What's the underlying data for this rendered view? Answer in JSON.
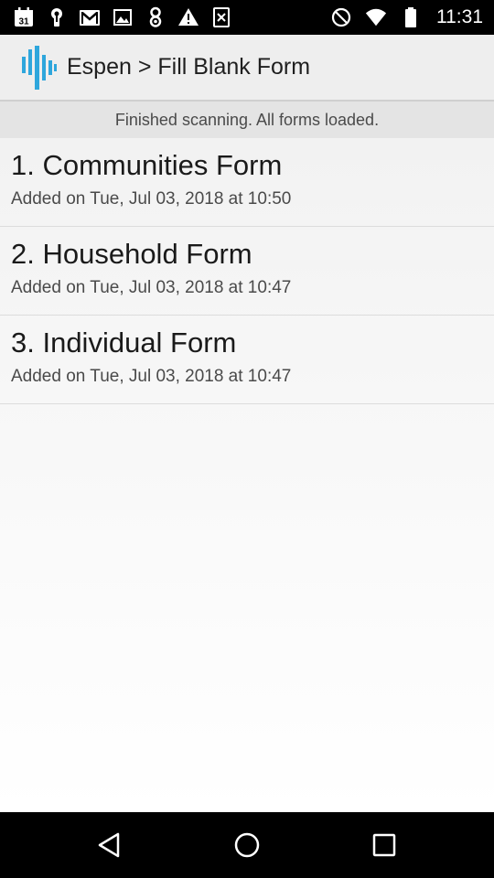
{
  "status_bar": {
    "time": "11:31",
    "calendar_day": "31",
    "left_icons": [
      "calendar-icon",
      "keyhole-icon",
      "gmail-icon",
      "image-icon",
      "android-icon",
      "warning-icon",
      "close-box-icon"
    ],
    "right_icons": [
      "do-not-disturb-icon",
      "wifi-icon",
      "battery-icon"
    ]
  },
  "app_bar": {
    "title": "Espen > Fill Blank Form",
    "logo_icon": "espen-logo-icon",
    "logo_color": "#2ea6dc"
  },
  "banner": {
    "text": "Finished scanning. All forms loaded."
  },
  "forms": [
    {
      "title": "1. Communities Form",
      "subtitle": "Added on Tue, Jul 03, 2018 at 10:50"
    },
    {
      "title": "2. Household Form",
      "subtitle": "Added on Tue, Jul 03, 2018 at 10:47"
    },
    {
      "title": "3. Individual Form",
      "subtitle": "Added on Tue, Jul 03, 2018 at 10:47"
    }
  ],
  "nav_bar": {
    "icons": [
      "back-icon",
      "home-icon",
      "recents-icon"
    ]
  }
}
